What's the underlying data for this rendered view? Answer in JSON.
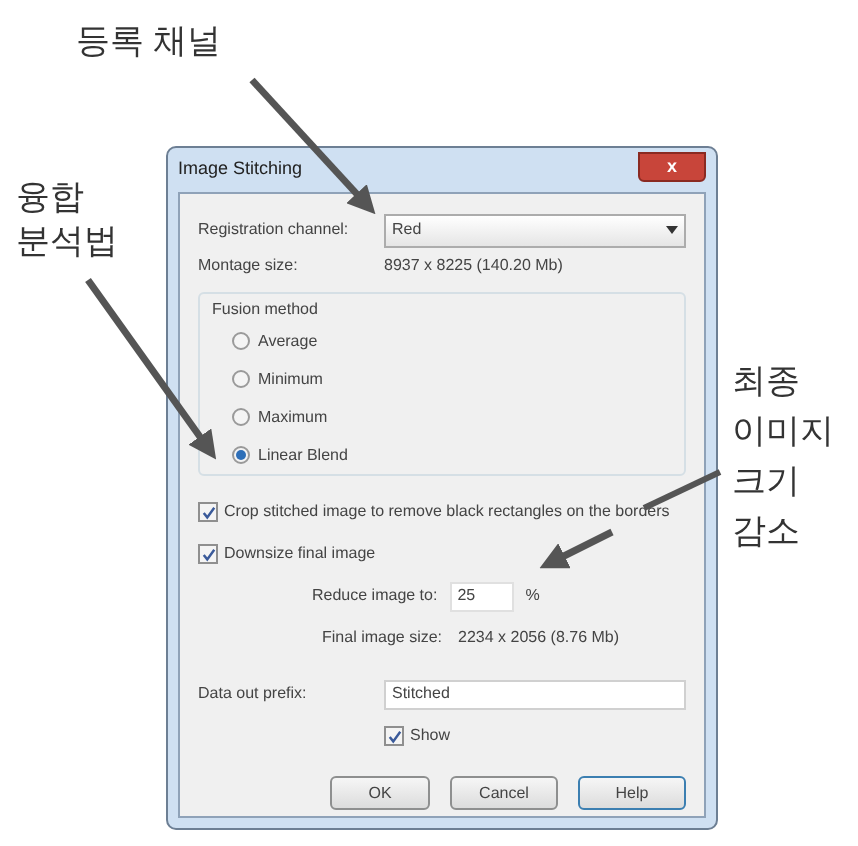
{
  "annotations": [
    {
      "text": "등록 채널"
    },
    {
      "text": "융합\n분석법"
    },
    {
      "text": "최종\n이미지\n크기\n감소"
    }
  ],
  "window": {
    "title": "Image Stitching",
    "close": "x"
  },
  "registration": {
    "label": "Registration channel:",
    "value": "Red"
  },
  "montage": {
    "label": "Montage size:",
    "value": "8937 x 8225 (140.20 Mb)"
  },
  "fusion": {
    "title": "Fusion method",
    "options": [
      {
        "label": "Average",
        "selected": false
      },
      {
        "label": "Minimum",
        "selected": false
      },
      {
        "label": "Maximum",
        "selected": false
      },
      {
        "label": "Linear Blend",
        "selected": true
      }
    ]
  },
  "crop": {
    "label": "Crop stitched image to remove black rectangles on the borders",
    "checked": true
  },
  "downsize": {
    "label": "Downsize final image",
    "checked": true
  },
  "reduce": {
    "label": "Reduce image to:",
    "value": "25",
    "unit": "%"
  },
  "final_size": {
    "label": "Final image size:",
    "value": "2234 x 2056 (8.76 Mb)"
  },
  "prefix": {
    "label": "Data out prefix:",
    "value": "Stitched"
  },
  "show": {
    "label": "Show",
    "checked": true
  },
  "buttons": [
    {
      "label": "OK",
      "kind": "plain"
    },
    {
      "label": "Cancel",
      "kind": "plain"
    },
    {
      "label": "Help",
      "kind": "default"
    }
  ]
}
